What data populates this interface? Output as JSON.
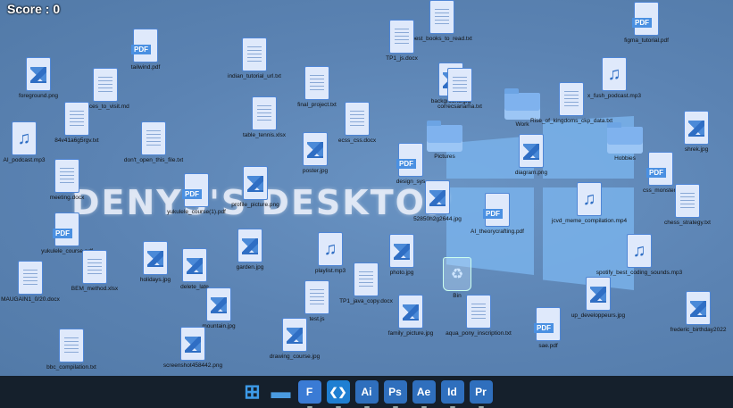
{
  "score": "Score : 0",
  "watermark": "DENYS'S DESKTOP",
  "icons": [
    {
      "label": "tailwind.pdf",
      "type": "pdf"
    },
    {
      "label": "foreground.png",
      "type": "img"
    },
    {
      "label": "places_to_visit.md",
      "type": "lines"
    },
    {
      "label": "84v41a6g5rgv.txt",
      "type": "lines"
    },
    {
      "label": "AI_podcast.mp3",
      "type": "mus"
    },
    {
      "label": "don't_open_this_file.txt",
      "type": "lines"
    },
    {
      "label": "meeting.docx",
      "type": "lines"
    },
    {
      "label": "yukulele_course.pdf",
      "type": "pdf"
    },
    {
      "label": "yukulele_course(1).pdf",
      "type": "pdf"
    },
    {
      "label": "MAUGAIN1_0/20.docx",
      "type": "lines"
    },
    {
      "label": "BEM_method.xlsx",
      "type": "lines"
    },
    {
      "label": "holidays.jpg",
      "type": "img"
    },
    {
      "label": "delete_late",
      "type": "img"
    },
    {
      "label": "mountain.jpg",
      "type": "img"
    },
    {
      "label": "bbc_compilation.txt",
      "type": "lines"
    },
    {
      "label": "screenshot458442.png",
      "type": "img"
    },
    {
      "label": "indian_tutorial_url.txt",
      "type": "lines"
    },
    {
      "label": "final_project.txt",
      "type": "lines"
    },
    {
      "label": "table_tennis.xlsx",
      "type": "lines"
    },
    {
      "label": "ecss_css.docx",
      "type": "lines"
    },
    {
      "label": "poster.jpg",
      "type": "img"
    },
    {
      "label": "profile_picture.png",
      "type": "img"
    },
    {
      "label": "garden.jpg",
      "type": "img"
    },
    {
      "label": "playlist.mp3",
      "type": "mus"
    },
    {
      "label": "TP1_java_copy.docx",
      "type": "lines"
    },
    {
      "label": "test.js",
      "type": "lines"
    },
    {
      "label": "drawing_course.jpg",
      "type": "img"
    },
    {
      "label": "best_books_to_read.txt",
      "type": "lines"
    },
    {
      "label": "TP1_js.docx",
      "type": "lines"
    },
    {
      "label": "background.jpg",
      "type": "img"
    },
    {
      "label": "correcsanama.txt",
      "type": "lines"
    },
    {
      "label": "Work",
      "type": "folder"
    },
    {
      "label": "Pictures",
      "type": "folder"
    },
    {
      "label": "design_sys",
      "type": "pdf"
    },
    {
      "label": "52850h2g2644.jpg",
      "type": "img"
    },
    {
      "label": "AI_theorycrafting.pdf",
      "type": "pdf"
    },
    {
      "label": "diagram.png",
      "type": "img"
    },
    {
      "label": "photo.jpg",
      "type": "img"
    },
    {
      "label": "Bin",
      "type": "bin"
    },
    {
      "label": "family_picture.jpg",
      "type": "img"
    },
    {
      "label": "aqua_pony_inscription.txt",
      "type": "lines"
    },
    {
      "label": "figma_tutorial.pdf",
      "type": "pdf"
    },
    {
      "label": "x_fush_podcast.mp3",
      "type": "mus"
    },
    {
      "label": "Rise_of_kingdoms_ckp_data.txt",
      "type": "lines"
    },
    {
      "label": "Hobbies",
      "type": "folder"
    },
    {
      "label": "shrek.jpg",
      "type": "img"
    },
    {
      "label": "css_monsters",
      "type": "pdf"
    },
    {
      "label": "chess_strategy.txt",
      "type": "lines"
    },
    {
      "label": "jcvd_meme_compilation.mp4",
      "type": "mus"
    },
    {
      "label": "spotify_best_coding_sounds.mp3",
      "type": "mus"
    },
    {
      "label": "up_developpeurs.jpg",
      "type": "img"
    },
    {
      "label": "sae.pdf",
      "type": "pdf"
    },
    {
      "label": "frederic_birthday2022",
      "type": "img"
    }
  ],
  "taskbar": [
    {
      "name": "windows-start-icon",
      "glyph": "⊞",
      "color": "#3d9be9"
    },
    {
      "name": "file-explorer-icon",
      "glyph": "▬",
      "color": "#4a9be0"
    },
    {
      "name": "figma-app-icon",
      "glyph": "F",
      "color": "#3a7bd5"
    },
    {
      "name": "vscode-app-icon",
      "glyph": "❮❯",
      "color": "#1f7fd2"
    },
    {
      "name": "illustrator-app-icon",
      "glyph": "Ai",
      "color": "#2f6fbd"
    },
    {
      "name": "photoshop-app-icon",
      "glyph": "Ps",
      "color": "#2f6fbd"
    },
    {
      "name": "after-effects-app-icon",
      "glyph": "Ae",
      "color": "#2f6fbd"
    },
    {
      "name": "indesign-app-icon",
      "glyph": "Id",
      "color": "#2f6fbd"
    },
    {
      "name": "premiere-app-icon",
      "glyph": "Pr",
      "color": "#2f6fbd"
    }
  ]
}
